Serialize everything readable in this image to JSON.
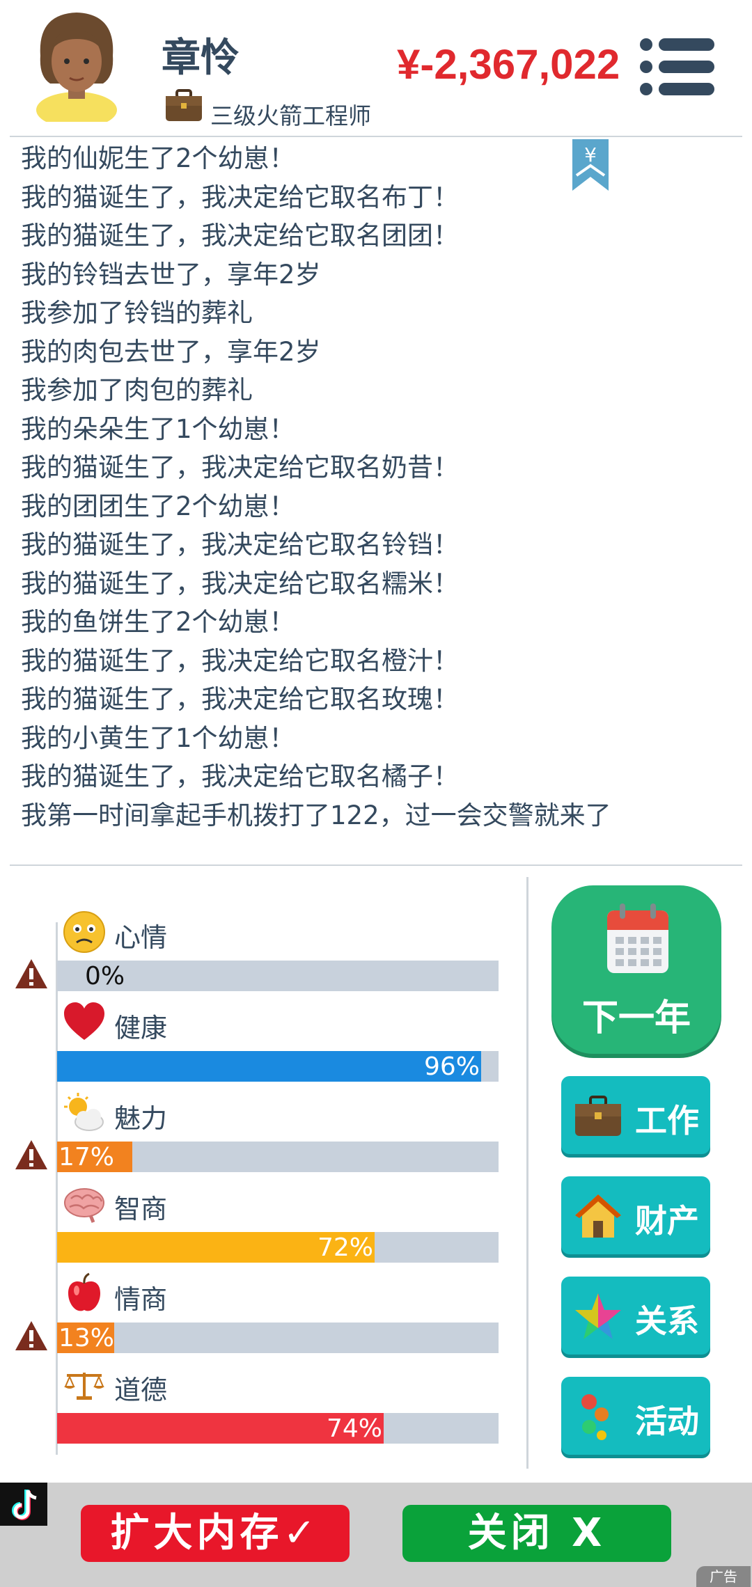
{
  "header": {
    "name": "章怜",
    "job_title": "三级火箭工程师",
    "money": "¥-2,367,022",
    "bookmark_symbol": "¥"
  },
  "log": [
    "我的仙妮生了2个幼崽！",
    "我的猫诞生了，我决定给它取名布丁！",
    "我的猫诞生了，我决定给它取名团团！",
    "我的铃铛去世了，享年2岁",
    "我参加了铃铛的葬礼",
    "我的肉包去世了，享年2岁",
    "我参加了肉包的葬礼",
    "我的朵朵生了1个幼崽！",
    "我的猫诞生了，我决定给它取名奶昔！",
    "我的团团生了2个幼崽！",
    "我的猫诞生了，我决定给它取名铃铛！",
    "我的猫诞生了，我决定给它取名糯米！",
    "我的鱼饼生了2个幼崽！",
    "我的猫诞生了，我决定给它取名橙汁！",
    "我的猫诞生了，我决定给它取名玫瑰！",
    "我的小黄生了1个幼崽！",
    "我的猫诞生了，我决定给它取名橘子！",
    "我第一时间拿起手机拨打了122，过一会交警就来了"
  ],
  "stats": [
    {
      "label": "心情",
      "value": 0,
      "pct": "0%",
      "color": "#c8d1dc",
      "icon": "sad-face-icon",
      "warning": true
    },
    {
      "label": "健康",
      "value": 96,
      "pct": "96%",
      "color": "#1a8ae0",
      "icon": "heart-icon",
      "warning": false
    },
    {
      "label": "魅力",
      "value": 17,
      "pct": "17%",
      "color": "#f2821f",
      "icon": "sun-cloud-icon",
      "warning": true
    },
    {
      "label": "智商",
      "value": 72,
      "pct": "72%",
      "color": "#fbb314",
      "icon": "brain-icon",
      "warning": false
    },
    {
      "label": "情商",
      "value": 13,
      "pct": "13%",
      "color": "#f2821f",
      "icon": "apple-icon",
      "warning": true
    },
    {
      "label": "道德",
      "value": 74,
      "pct": "74%",
      "color": "#ef3440",
      "icon": "scales-icon",
      "warning": false
    }
  ],
  "buttons": {
    "next_year": "下一年",
    "work": "工作",
    "property": "财产",
    "relations": "关系",
    "activities": "活动"
  },
  "ad": {
    "expand_label": "扩大内存✓",
    "close_label": "关闭  X",
    "tag": "广告"
  }
}
